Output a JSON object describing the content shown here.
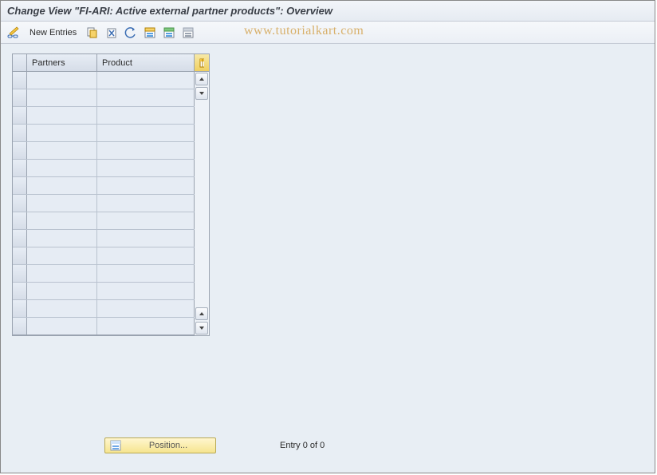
{
  "title": "Change View \"FI-ARI: Active external partner products\": Overview",
  "toolbar": {
    "new_entries_label": "New Entries"
  },
  "watermark": "www.tutorialkart.com",
  "table": {
    "columns": {
      "partners": "Partners",
      "product": "Product"
    },
    "rows": [
      {
        "partners": "",
        "product": ""
      },
      {
        "partners": "",
        "product": ""
      },
      {
        "partners": "",
        "product": ""
      },
      {
        "partners": "",
        "product": ""
      },
      {
        "partners": "",
        "product": ""
      },
      {
        "partners": "",
        "product": ""
      },
      {
        "partners": "",
        "product": ""
      },
      {
        "partners": "",
        "product": ""
      },
      {
        "partners": "",
        "product": ""
      },
      {
        "partners": "",
        "product": ""
      },
      {
        "partners": "",
        "product": ""
      },
      {
        "partners": "",
        "product": ""
      },
      {
        "partners": "",
        "product": ""
      },
      {
        "partners": "",
        "product": ""
      },
      {
        "partners": "",
        "product": ""
      }
    ]
  },
  "footer": {
    "position_label": "Position...",
    "entry_text": "Entry 0 of 0"
  }
}
